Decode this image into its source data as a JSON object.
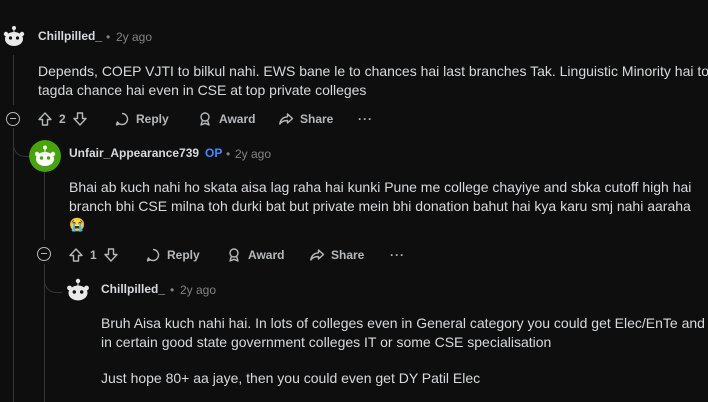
{
  "comments": [
    {
      "username": "Chillpilled_",
      "separator": "•",
      "time": "2y ago",
      "body_lines": [
        "Depends, COEP VJTI to bilkul nahi. EWS bane le to chances hai last branches Tak. Linguistic Minority hai to",
        "tagda chance hai even in CSE at top private colleges"
      ],
      "votes": "2",
      "reply_label": "Reply",
      "award_label": "Award",
      "share_label": "Share",
      "more_label": "···"
    },
    {
      "username": "Unfair_Appearance739",
      "op_badge": "OP",
      "separator": "•",
      "time": "2y ago",
      "body_lines": [
        "Bhai ab kuch nahi ho skata aisa lag raha hai kunki Pune me college chayiye and sbka cutoff high hai",
        "branch bhi CSE milna toh durki bat but private mein bhi donation bahut hai kya karu smj nahi aaraha"
      ],
      "emoji": "😭",
      "votes": "1",
      "reply_label": "Reply",
      "award_label": "Award",
      "share_label": "Share",
      "more_label": "···"
    },
    {
      "username": "Chillpilled_",
      "separator": "•",
      "time": "2y ago",
      "body_lines": [
        "Bruh Aisa kuch nahi hai. In lots of colleges even in General category you could get Elec/EnTe and",
        "in certain good state government colleges IT or some CSE specialisation"
      ],
      "body_line_2": "Just hope 80+ aa jaye, then you could even get DY Patil Elec"
    }
  ],
  "colors": {
    "background": "#0e0e0f",
    "text": "#d7dadc",
    "meta": "#818384",
    "op": "#3d8bff",
    "avatar_green": "#46a508"
  }
}
